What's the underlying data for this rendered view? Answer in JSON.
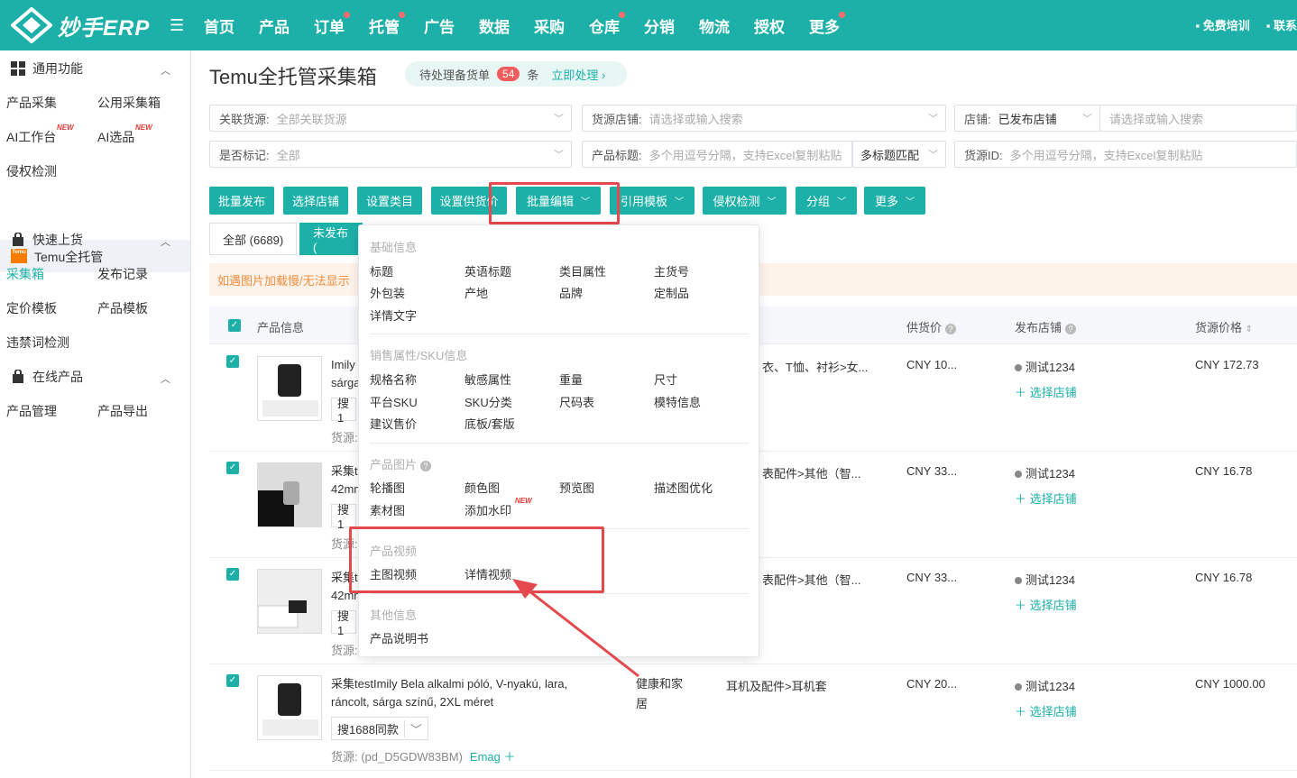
{
  "app": {
    "logo_text": "妙手ERP"
  },
  "topnav": {
    "items": [
      {
        "label": "首页",
        "dot": false
      },
      {
        "label": "产品",
        "dot": false
      },
      {
        "label": "订单",
        "dot": true
      },
      {
        "label": "托管",
        "dot": true
      },
      {
        "label": "广告",
        "dot": false
      },
      {
        "label": "数据",
        "dot": false
      },
      {
        "label": "采购",
        "dot": false
      },
      {
        "label": "仓库",
        "dot": true
      },
      {
        "label": "分销",
        "dot": false
      },
      {
        "label": "物流",
        "dot": false
      },
      {
        "label": "授权",
        "dot": false
      },
      {
        "label": "更多",
        "dot": true
      }
    ],
    "training": "免费培训",
    "contact": "联系"
  },
  "sidebar": {
    "common": {
      "title": "通用功能",
      "items": [
        "产品采集",
        "公用采集箱",
        "AI工作台",
        "AI选品",
        "侵权检测"
      ],
      "new_tag": "NEW"
    },
    "temu": "Temu全托管",
    "temu_badge": "Temu",
    "quick": {
      "title": "快速上货",
      "items": [
        "采集箱",
        "发布记录",
        "定价模板",
        "产品模板",
        "违禁词检测"
      ]
    },
    "online": {
      "title": "在线产品",
      "items": [
        "产品管理",
        "产品导出"
      ]
    }
  },
  "page": {
    "title": "Temu全托管采集箱",
    "pending": {
      "label": "待处理备货单",
      "count": "54",
      "unit": "条",
      "action": "立即处理 ›"
    }
  },
  "filters": {
    "related_source": {
      "label": "关联货源:",
      "placeholder": "全部关联货源"
    },
    "source_store": {
      "label": "货源店铺:",
      "placeholder": "请选择或输入搜索"
    },
    "store": {
      "label": "店铺:",
      "value": "已发布店铺",
      "placeholder": "请选择或输入搜索"
    },
    "marked": {
      "label": "是否标记:",
      "value": "全部"
    },
    "product_title": {
      "label": "产品标题:",
      "placeholder": "多个用逗号分隔，支持Excel复制粘贴",
      "mode": "多标题匹配"
    },
    "source_id": {
      "label": "货源ID:",
      "placeholder": "多个用逗号分隔，支持Excel复制粘贴"
    }
  },
  "toolbar": {
    "batch_publish": "批量发布",
    "select_store": "选择店铺",
    "set_category": "设置类目",
    "set_price": "设置供货价",
    "batch_edit": "批量编辑",
    "apply_template": "引用模板",
    "infringement": "侵权检测",
    "group": "分组",
    "more": "更多"
  },
  "tabs": {
    "all": "全部 (6689)",
    "unpublished": "未发布 ("
  },
  "banner": "如遇图片加载慢/无法显示",
  "table": {
    "headers": {
      "product": "产品信息",
      "supply_price": "供货价",
      "publish_store": "发布店铺",
      "source_price": "货源价格"
    },
    "rows": [
      {
        "title": "Imily",
        "title2": "sárga",
        "search": "搜1",
        "source": "货源:",
        "category": "衣、T恤、衬衫>女...",
        "supply": "CNY 10...",
        "store": "测试1234",
        "pick": "选择店铺",
        "price": "CNY 172.73"
      },
      {
        "title": "采集t",
        "title2": "42mm",
        "search": "搜1",
        "source": "货源:",
        "category": "表配件>其他（智...",
        "supply": "CNY 33...",
        "store": "测试1234",
        "pick": "选择店铺",
        "price": "CNY 16.78"
      },
      {
        "title": "采集t",
        "title2": "42mm",
        "search": "搜1",
        "source": "货源:",
        "category": "表配件>其他（智...",
        "supply": "CNY 33...",
        "store": "测试1234",
        "pick": "选择店铺",
        "price": "CNY 16.78"
      },
      {
        "title": "采集testImily Bela alkalmi póló, V-nyakú, lara, ráncolt, sárga színű, 2XL méret",
        "search": "搜1688同款",
        "source": "货源: (pd_D5GDW83BM)",
        "emag": "Emag ＋",
        "group": "健康和家居",
        "category": "耳机及配件>耳机套",
        "supply": "CNY 20...",
        "store": "测试1234",
        "pick": "选择店铺",
        "price": "CNY 1000.00"
      }
    ]
  },
  "dropdown": {
    "basic": {
      "title": "基础信息",
      "items": [
        "标题",
        "英语标题",
        "类目属性",
        "主货号",
        "外包装",
        "产地",
        "品牌",
        "定制品",
        "详情文字"
      ]
    },
    "sales": {
      "title": "销售属性/SKU信息",
      "items": [
        "规格名称",
        "敏感属性",
        "重量",
        "尺寸",
        "平台SKU",
        "SKU分类",
        "尺码表",
        "模特信息",
        "建议售价",
        "底板/套版"
      ]
    },
    "images": {
      "title": "产品图片",
      "items": [
        "轮播图",
        "颜色图",
        "预览图",
        "描述图优化",
        "素材图",
        "添加水印"
      ],
      "new_tag": "NEW"
    },
    "video": {
      "title": "产品视频",
      "items": [
        "主图视频",
        "详情视频"
      ]
    },
    "other": {
      "title": "其他信息",
      "items": [
        "产品说明书"
      ]
    }
  },
  "colors": {
    "accent": "#1cb0a8",
    "highlight": "#e5484d"
  }
}
